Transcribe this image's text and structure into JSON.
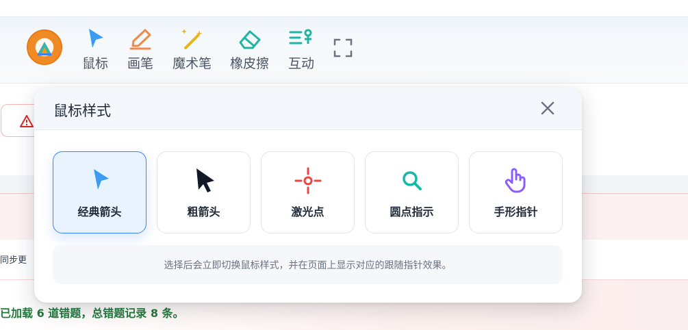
{
  "toolbar": {
    "tools": [
      {
        "label": "鼠标",
        "icon": "cursor-arrow-icon"
      },
      {
        "label": "画笔",
        "icon": "pen-icon"
      },
      {
        "label": "魔术笔",
        "icon": "magic-wand-icon"
      },
      {
        "label": "橡皮擦",
        "icon": "eraser-icon"
      },
      {
        "label": "互动",
        "icon": "interaction-icon"
      }
    ],
    "fullscreen_icon": "fullscreen-icon",
    "logo_icon": "school-logo"
  },
  "background": {
    "sync_text": "同步更",
    "status_text": "已加载 6 道错题，总错题记录 8 条。"
  },
  "modal": {
    "title": "鼠标样式",
    "close_icon": "close-icon",
    "options": [
      {
        "label": "经典箭头",
        "icon": "classic-arrow-icon",
        "selected": true
      },
      {
        "label": "粗箭头",
        "icon": "bold-arrow-icon",
        "selected": false
      },
      {
        "label": "激光点",
        "icon": "laser-dot-icon",
        "selected": false
      },
      {
        "label": "圆点指示",
        "icon": "magnifier-icon",
        "selected": false
      },
      {
        "label": "手形指针",
        "icon": "hand-pointer-icon",
        "selected": false
      }
    ],
    "hint": "选择后会立即切换鼠标样式，并在页面上显示对应的跟随指针效果。"
  },
  "colors": {
    "accent_blue": "#3b82f6",
    "pen_orange": "#f08a4b",
    "magic_yellow": "#e6b422",
    "eraser_teal": "#1fb5a0",
    "laser_red": "#ef4444",
    "hand_purple": "#8b5cf6",
    "status_green": "#1f7a3a"
  }
}
